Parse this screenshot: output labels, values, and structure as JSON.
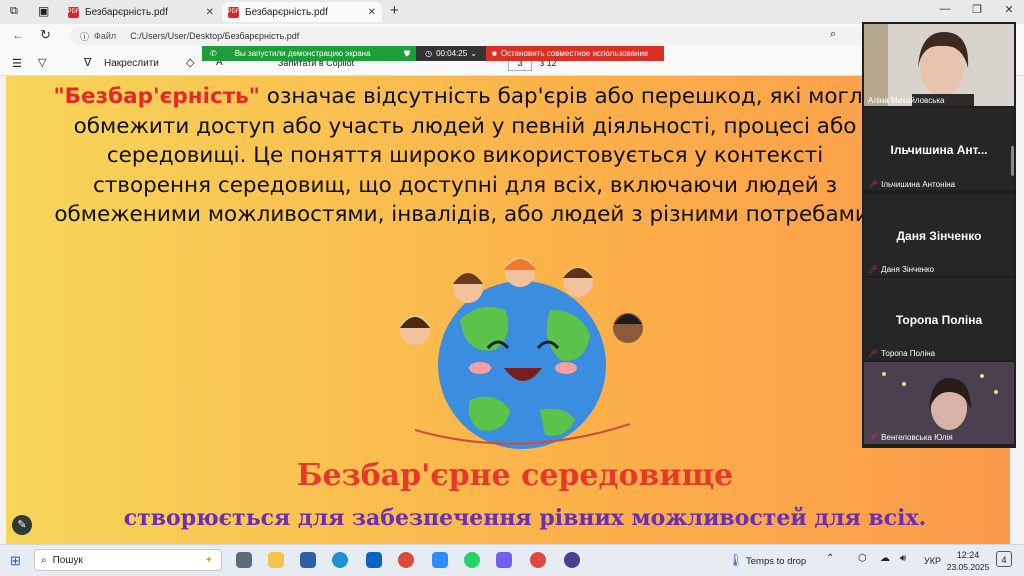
{
  "browser": {
    "tabs": [
      {
        "label": "Безбарєрність.pdf"
      },
      {
        "label": "Безбарєрність.pdf"
      }
    ],
    "new_tab": "+",
    "address": {
      "label": "Файл",
      "url": "C:/Users/User/Desktop/Безбарєрність.pdf"
    }
  },
  "pdf_toolbar": {
    "draw": "Накреслити",
    "copilot": "Запитати в Copilot",
    "page_current": "3",
    "page_total": "з 12",
    "font_button": "A"
  },
  "share_banner": {
    "status": "Вы запустили демонстрацию экрана",
    "timer": "00:04:25",
    "stop": "Остановить совместное использование"
  },
  "slide": {
    "highlight": "\"Безбар'єрність\"",
    "paragraph": " означає відсутність бар'єрів або перешкод, які могли обмежити доступ або участь людей у певній діяльності, процесі або середовищі. Це поняття широко використовується у контексті створення середовищ, що доступні для всіх, включаючи людей з обмеженими можливостями, інвалідів, або людей з різними потребами.",
    "title": "Безбар'єрне середовище",
    "subtitle": "створюється для забезпечення рівних можливостей для всіх."
  },
  "participants": [
    {
      "label": "Аліна Михайловська",
      "video": true
    },
    {
      "name": "Ільчишина  Ант...",
      "label": "Ільчишина Антоніна",
      "video": false
    },
    {
      "name": "Даня Зінченко",
      "label": "Даня Зінченко",
      "video": false
    },
    {
      "name": "Торопа Поліна",
      "label": "Торопа Поліна",
      "video": false
    },
    {
      "label": "Венгеловська Юлія",
      "video": true
    }
  ],
  "taskbar": {
    "search": "Пошук",
    "weather": "Temps to drop",
    "lang": "УКР",
    "time": "12:24",
    "date": "23.05.2025",
    "notif": "4"
  },
  "colors": {
    "highlight": "#e9262a",
    "title": "#e6392c",
    "subtitle": "#6a2fb4",
    "share_green": "#1e9e3a",
    "share_red": "#d93025"
  }
}
